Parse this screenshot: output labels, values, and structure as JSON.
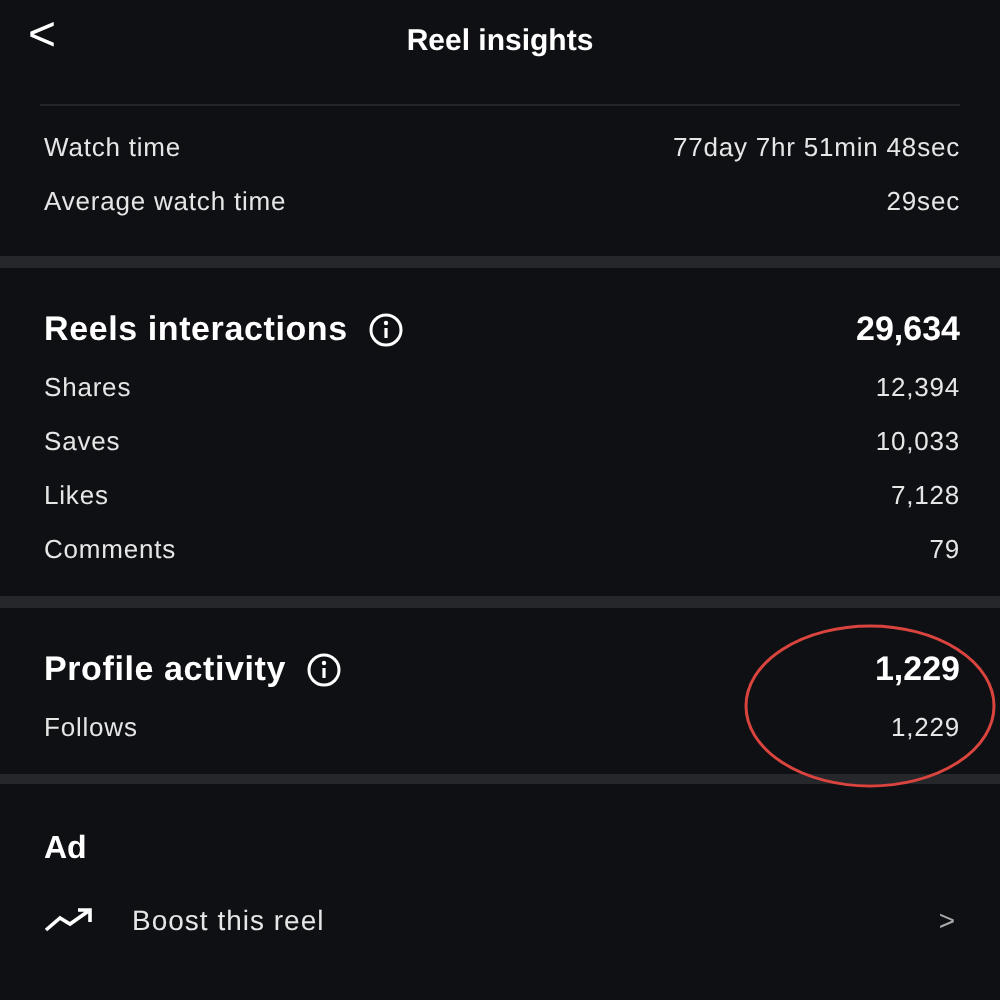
{
  "header": {
    "back": "<",
    "title": "Reel insights"
  },
  "summary": {
    "rows": [
      {
        "label": "Watch time",
        "value": "77day 7hr 51min 48sec"
      },
      {
        "label": "Average watch time",
        "value": "29sec"
      }
    ]
  },
  "sections": [
    {
      "title": "Reels interactions",
      "total": "29,634",
      "highlighted": false,
      "rows": [
        {
          "label": "Shares",
          "value": "12,394"
        },
        {
          "label": "Saves",
          "value": "10,033"
        },
        {
          "label": "Likes",
          "value": "7,128"
        },
        {
          "label": "Comments",
          "value": "79"
        }
      ]
    },
    {
      "title": "Profile activity",
      "total": "1,229",
      "highlighted": true,
      "rows": [
        {
          "label": "Follows",
          "value": "1,229"
        }
      ]
    }
  ],
  "ad": {
    "title": "Ad",
    "action": "Boost this reel",
    "chevron": ">"
  }
}
